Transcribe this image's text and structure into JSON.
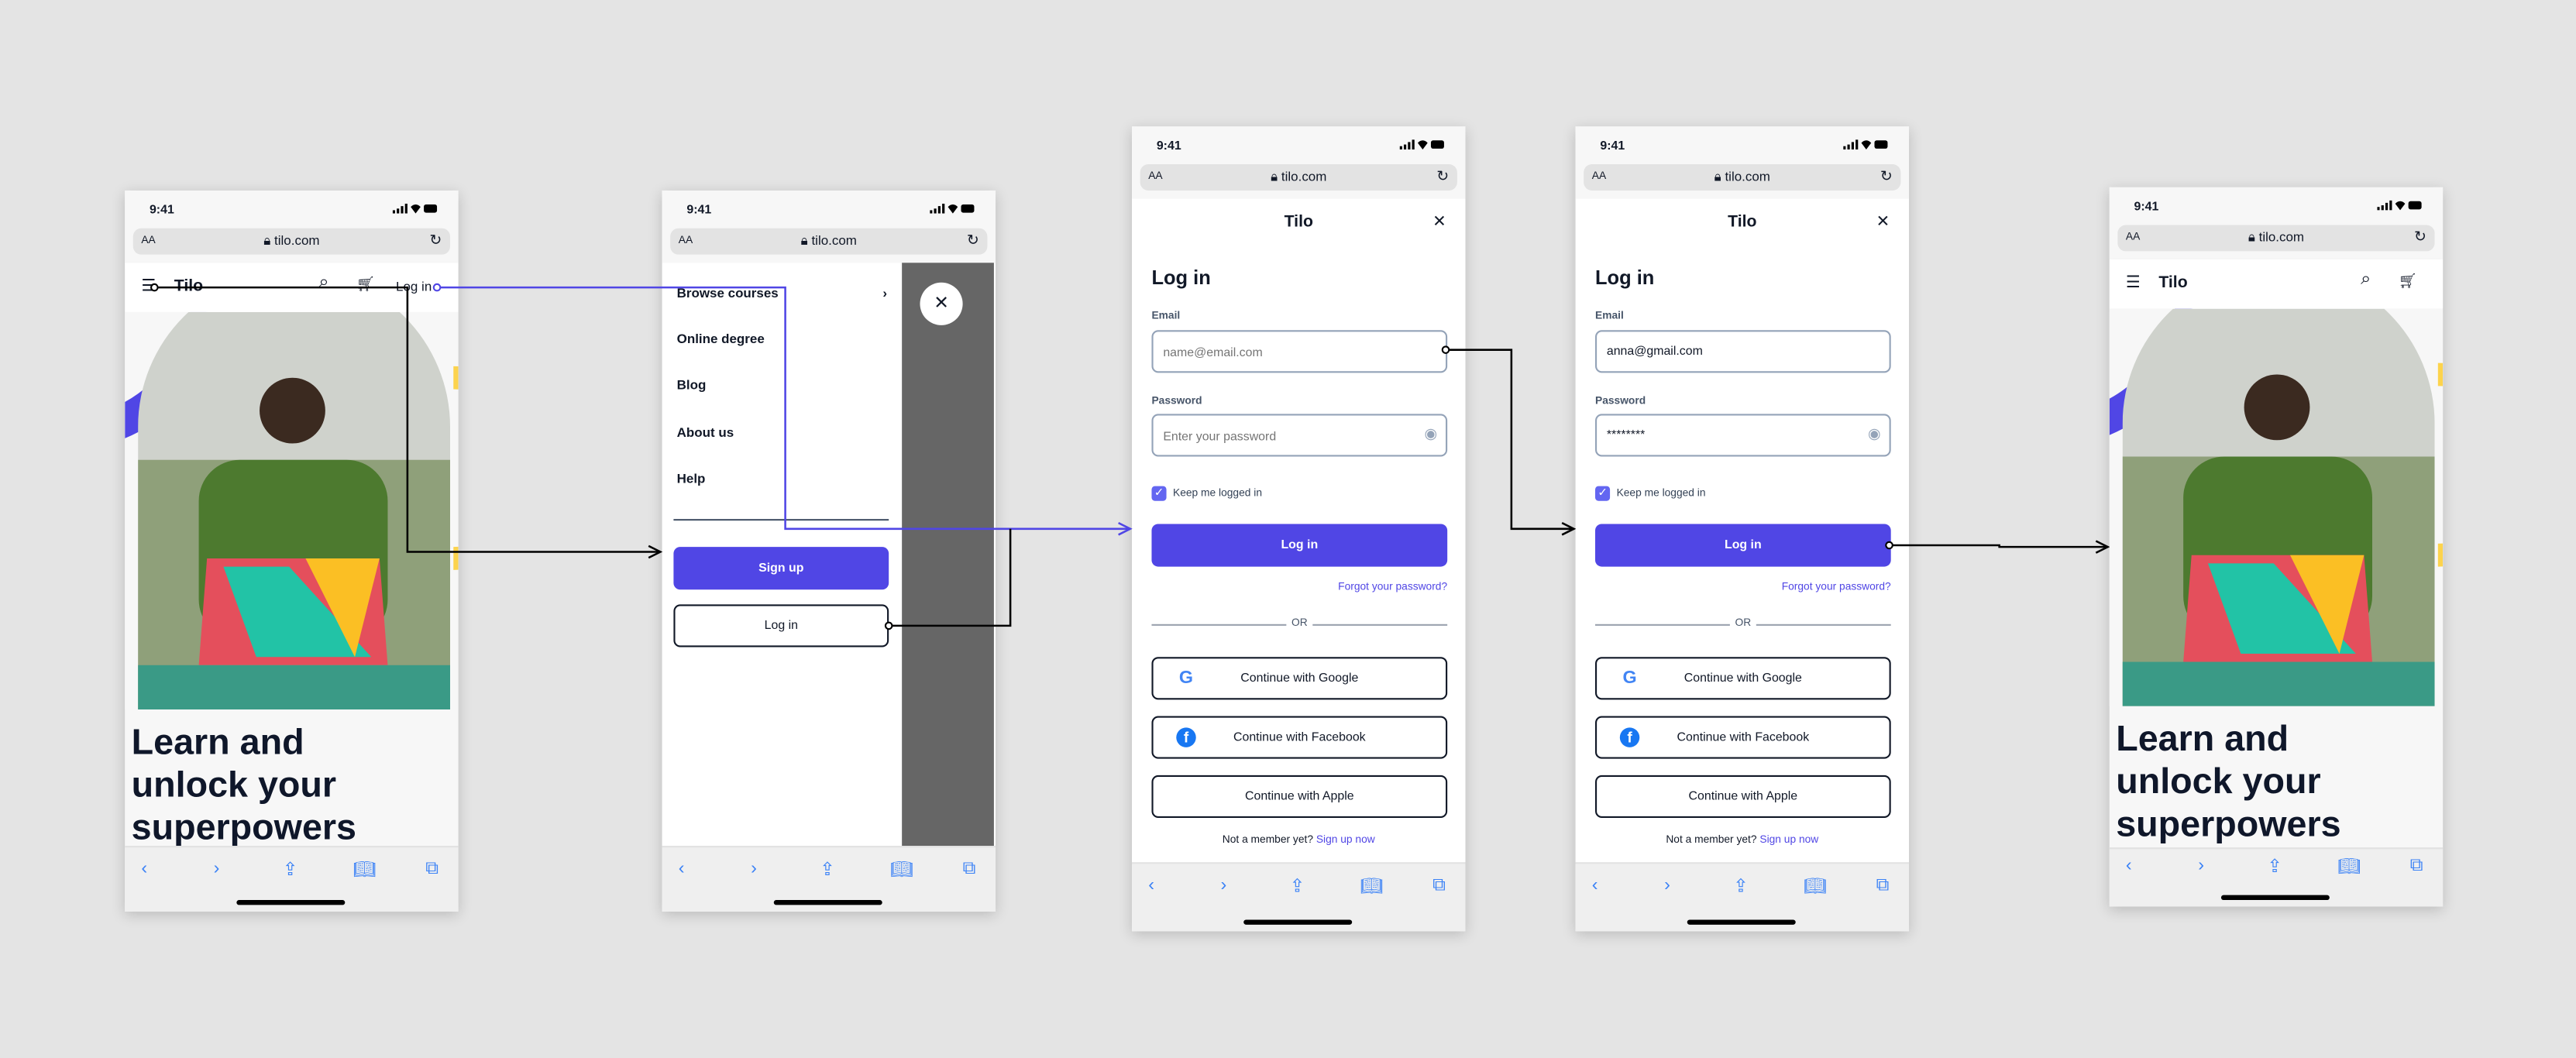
{
  "colors": {
    "brand": "#5046e5",
    "background": "#e4e4e4",
    "headline": "#0f172a",
    "overlay": "#666666",
    "link": "#5046e5"
  },
  "browser": {
    "time": "9:41",
    "aa": "AA",
    "url": "tilo.com"
  },
  "home": {
    "logo": "Tilo",
    "login_link": "Log in",
    "headline": [
      "Learn and",
      "unlock your",
      "superpowers"
    ]
  },
  "menu": {
    "items": [
      "Browse courses",
      "Online degree",
      "Blog",
      "About us",
      "Help"
    ],
    "signup": "Sign up",
    "login": "Log in"
  },
  "login": {
    "logo": "Tilo",
    "title": "Log in",
    "email_label": "Email",
    "email_placeholder": "name@email.com",
    "password_label": "Password",
    "password_placeholder": "Enter your password",
    "keep_logged_in": "Keep me logged in",
    "keep_logged_in_checked": true,
    "submit": "Log in",
    "forgot": "Forgot your password?",
    "or": "OR",
    "google": "Continue with Google",
    "facebook": "Continue with Facebook",
    "apple": "Continue with Apple",
    "not_member": "Not a member yet?",
    "signup_link": "Sign up now"
  },
  "login_filled": {
    "email_value": "anna@gmail.com",
    "password_value": "********"
  }
}
